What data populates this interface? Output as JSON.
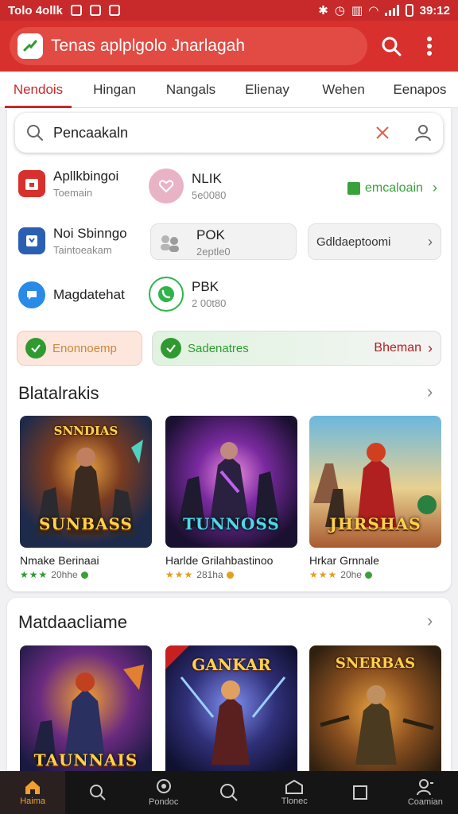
{
  "status_bar": {
    "left_text": "Tolo 4ollk",
    "time": "39:12",
    "background": "#c8292a"
  },
  "app_bar": {
    "title": "Tenas aplplgolo Jnarlagah",
    "background": "#d8302c",
    "icons": [
      "app-logo-icon",
      "search-icon",
      "more-vert-icon"
    ]
  },
  "tabs": [
    {
      "label": "Nendois",
      "active": true
    },
    {
      "label": "Hingan",
      "active": false
    },
    {
      "label": "Nangals",
      "active": false
    },
    {
      "label": "Elienay",
      "active": false
    },
    {
      "label": "Wehen",
      "active": false
    },
    {
      "label": "Eenapos",
      "active": false
    }
  ],
  "search": {
    "value": "Pencaakaln",
    "icons": [
      "search-icon",
      "clear-icon",
      "person-icon"
    ]
  },
  "quick_apps": {
    "left": [
      {
        "name": "Apllkbingoi",
        "sub": "Toemain",
        "icon": "calendar-icon",
        "color": "#d8302c"
      },
      {
        "name": "Noi Sbinngo",
        "sub": "Taintoeakam",
        "icon": "store-icon",
        "color": "#2b5fb3"
      },
      {
        "name": "Magdatehat",
        "sub": "",
        "icon": "chat-icon",
        "color": "#2a8ae8"
      }
    ],
    "middle": [
      {
        "name": "NLIK",
        "sub": "5e0080",
        "icon": "heart-chat-icon",
        "color": "#d88aa8"
      },
      {
        "name": "POK",
        "sub": "2eptle0",
        "icon": "people-icon",
        "color": "#9a9a9a"
      },
      {
        "name": "PBK",
        "sub": "2 00t80",
        "icon": "whatsapp-icon",
        "color": "#2fb34a"
      }
    ],
    "right": {
      "link_label": "emcaloain",
      "button_label": "Gdldaeptoomi"
    }
  },
  "pills": {
    "left_label": "Enonnoemp",
    "middle_label": "Sadenatres",
    "right_label": "Bheman",
    "accent_green": "#2f9a2f",
    "accent_red": "#b52020"
  },
  "section1": {
    "title": "Blatalrakis",
    "games": [
      {
        "name": "Nmake Berinaai",
        "rating": "20hhe",
        "stars": 3,
        "top_text": "SNNDIAS",
        "logo_text": "SUNBASS",
        "badge_color": "#3aa13a"
      },
      {
        "name": "Harlde Grilahbastinoo",
        "rating": "281ha",
        "stars": 3,
        "top_text": "",
        "logo_text": "TUNNOSS",
        "badge_color": "#e0a020"
      },
      {
        "name": "Hrkar Grnnale",
        "rating": "20he",
        "stars": 3,
        "top_text": "",
        "logo_text": "JHRSHAS",
        "badge_color": "#3aa13a"
      }
    ]
  },
  "section2": {
    "title": "Matdaacliame",
    "games": [
      {
        "logo_text": "TAUNNAIS",
        "top_text": ""
      },
      {
        "logo_text": "",
        "top_text": "GANKAR"
      },
      {
        "logo_text": "",
        "top_text": "SNERBAS"
      }
    ]
  },
  "bottom_nav": [
    {
      "label": "Haima",
      "icon": "home-icon",
      "active": true
    },
    {
      "label": "",
      "icon": "search-icon",
      "active": false
    },
    {
      "label": "Pondoc",
      "icon": "badge-icon",
      "active": false
    },
    {
      "label": "",
      "icon": "search-icon",
      "active": false
    },
    {
      "label": "Tlonec",
      "icon": "inbox-icon",
      "active": false
    },
    {
      "label": "",
      "icon": "square-icon",
      "active": false
    },
    {
      "label": "Coamian",
      "icon": "account-icon",
      "active": false
    }
  ]
}
